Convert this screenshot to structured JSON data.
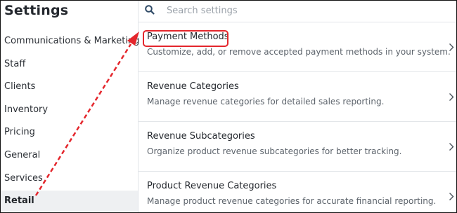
{
  "sidebar": {
    "title": "Settings",
    "items": [
      {
        "label": "Communications & Marketing"
      },
      {
        "label": "Staff"
      },
      {
        "label": "Clients"
      },
      {
        "label": "Inventory"
      },
      {
        "label": "Pricing"
      },
      {
        "label": "General"
      },
      {
        "label": "Services"
      },
      {
        "label": "Retail",
        "active": true
      }
    ]
  },
  "search": {
    "placeholder": "Search settings",
    "icon": "search-icon"
  },
  "settings_list": [
    {
      "title": "Payment Methods",
      "description": "Customize, add, or remove accepted payment methods in your system."
    },
    {
      "title": "Revenue Categories",
      "description": "Manage revenue categories for detailed sales reporting."
    },
    {
      "title": "Revenue Subcategories",
      "description": "Organize product revenue subcategories for better tracking."
    },
    {
      "title": "Product Revenue Categories",
      "description": "Manage product revenue categories for accurate financial reporting."
    }
  ],
  "annotation": {
    "highlight_color": "#e4262c",
    "highlighted_item": "Payment Methods",
    "arrow_from": "Retail"
  }
}
